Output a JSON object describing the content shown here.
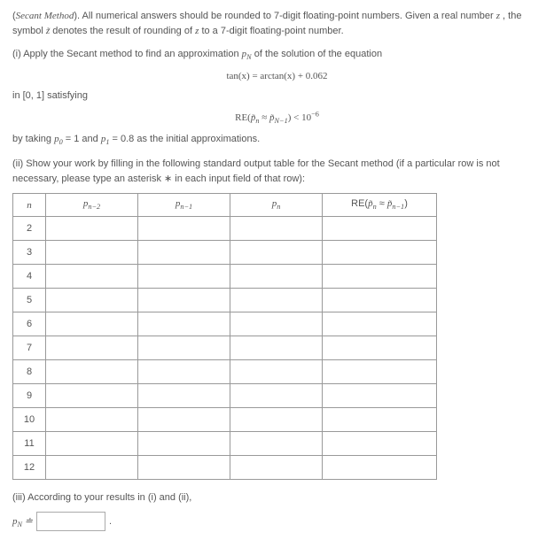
{
  "intro": {
    "title_prefix": "(Secant Method).",
    "title_rest": " All numerical answers should be rounded to 7-digit floating-point numbers. Given a real number ",
    "title_after_symbol": ", the symbol ",
    "title_end": " denotes the result of rounding of ",
    "title_tail": " to a 7-digit floating-point number."
  },
  "part_i": {
    "lead": "(i) Apply the Secant method to find an approximation ",
    "lead_after": " of the solution of the equation",
    "equation": "tan(x) = arctan(x) + 0.062",
    "interval_lead": "in [0, 1] satisfying",
    "criterion": "RE(p̃ₙ ≈ p̃ₙ₋₁) < 10⁻⁶",
    "initial": "by taking p₀ = 1 and p₁ = 0.8 as the initial approximations."
  },
  "part_ii": {
    "text": "(ii) Show your work by filling in the following standard output table for the Secant method (if a particular row is not necessary, please type an asterisk ∗ in each input field of that row):"
  },
  "table": {
    "headers": {
      "n": "n",
      "pn2": "pₙ₋₂",
      "pn1": "pₙ₋₁",
      "pn": "pₙ",
      "re": "RE(p̃ₙ ≈ p̃ₙ₋₁)"
    },
    "rows": [
      2,
      3,
      4,
      5,
      6,
      7,
      8,
      9,
      10,
      11,
      12
    ]
  },
  "part_iii": {
    "text": "(iii) According to your results in (i) and (ii),",
    "label": "pₙ ≐",
    "final_period": "."
  }
}
